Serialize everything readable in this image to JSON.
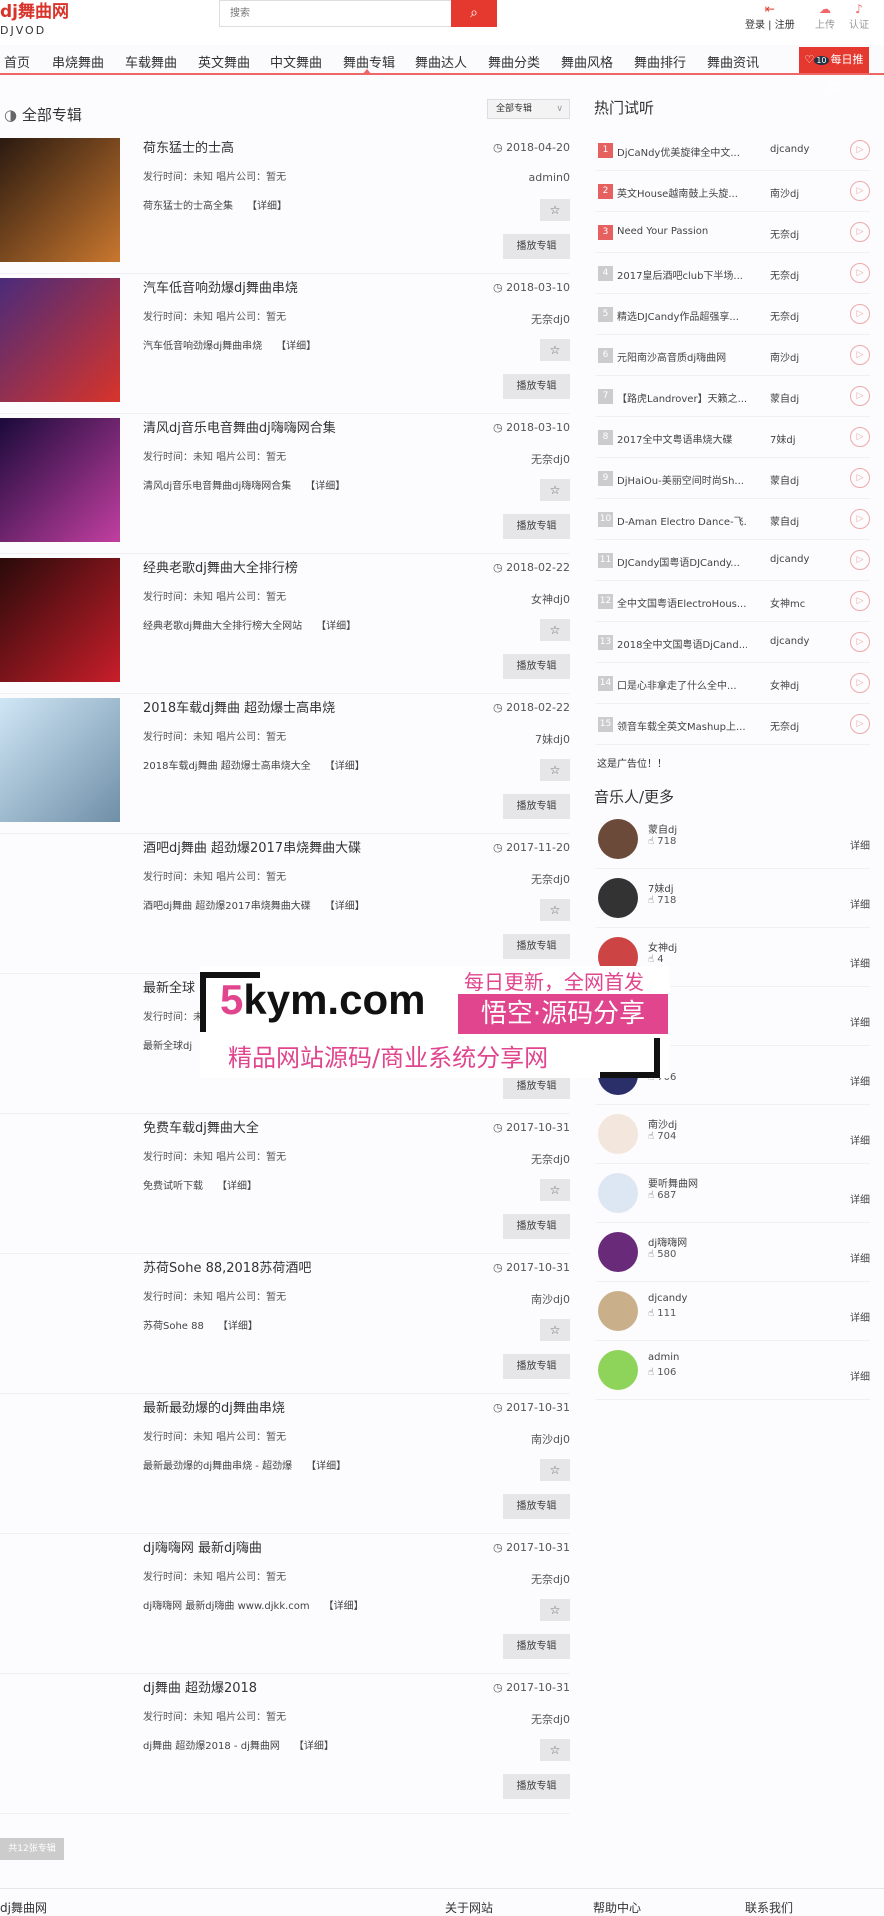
{
  "header": {
    "logo": "dj舞曲网",
    "logo_sub": "DJVOD",
    "search_placeholder": "搜索",
    "login": "登录 | 注册",
    "upload": "上传",
    "verify": "认证"
  },
  "nav": {
    "items": [
      "首页",
      "串烧舞曲",
      "车载舞曲",
      "英文舞曲",
      "中文舞曲",
      "舞曲专辑",
      "舞曲达人",
      "舞曲分类",
      "舞曲风格",
      "舞曲排行",
      "舞曲资讯"
    ],
    "active": "舞曲专辑",
    "daily": "每日推荐",
    "daily_badge": "10"
  },
  "main": {
    "title": "全部专辑",
    "filter": "全部专辑",
    "meta": "发行时间：未知 唱片公司：暂无",
    "more": "【详细】",
    "play": "播放专辑",
    "pager": "共12张专辑",
    "albums": [
      {
        "title": "荷东猛士的士高",
        "desc": "荷东猛士的士高全集",
        "date": "2018-04-20",
        "author": "admin0",
        "cover": [
          "#2a1a10",
          "#c9772e"
        ]
      },
      {
        "title": "汽车低音响劲爆dj舞曲串烧",
        "desc": "汽车低音响劲爆dj舞曲串烧",
        "date": "2018-03-10",
        "author": "无奈dj0",
        "cover": [
          "#4a2b7a",
          "#d8342a"
        ]
      },
      {
        "title": "清风dj音乐电音舞曲dj嗨嗨网合集",
        "desc": "清风dj音乐电音舞曲dj嗨嗨网合集",
        "date": "2018-03-10",
        "author": "无奈dj0",
        "cover": [
          "#1a0a3a",
          "#c23fa0"
        ]
      },
      {
        "title": "经典老歌dj舞曲大全排行榜",
        "desc": "经典老歌dj舞曲大全排行榜大全网站",
        "date": "2018-02-22",
        "author": "女神dj0",
        "cover": [
          "#2a0a0a",
          "#c81e2a"
        ]
      },
      {
        "title": "2018车载dj舞曲 超劲爆士高串烧",
        "desc": "2018车载dj舞曲 超劲爆士高串烧大全",
        "date": "2018-02-22",
        "author": "7妹dj0",
        "cover": [
          "#cfe6f5",
          "#6f8fa8"
        ]
      },
      {
        "title": "酒吧dj舞曲 超劲爆2017串烧舞曲大碟",
        "desc": "酒吧dj舞曲 超劲爆2017串烧舞曲大碟",
        "date": "2017-11-20",
        "author": "无奈dj0"
      },
      {
        "title": "最新全球",
        "desc": "最新全球dj",
        "date": "",
        "author": ""
      },
      {
        "title": "免费车载dj舞曲大全",
        "desc": "免费试听下载",
        "date": "2017-10-31",
        "author": "无奈dj0"
      },
      {
        "title": "苏荷Sohe 88,2018苏荷酒吧",
        "desc": "苏荷Sohe 88",
        "date": "2017-10-31",
        "author": "南沙dj0"
      },
      {
        "title": "最新最劲爆的dj舞曲串烧",
        "desc": "最新最劲爆的dj舞曲串烧 - 超劲爆",
        "date": "2017-10-31",
        "author": "南沙dj0"
      },
      {
        "title": "dj嗨嗨网 最新dj嗨曲",
        "desc": "dj嗨嗨网 最新dj嗨曲 www.djkk.com",
        "date": "2017-10-31",
        "author": "无奈dj0"
      },
      {
        "title": "dj舞曲 超劲爆2018",
        "desc": "dj舞曲 超劲爆2018 - dj舞曲网",
        "date": "2017-10-31",
        "author": "无奈dj0"
      }
    ]
  },
  "sidebar": {
    "hot_title": "热门试听",
    "ad": "这是广告位！！",
    "musicians_title": "音乐人/更多",
    "detail": "详细",
    "hot": [
      {
        "n": "1",
        "t": "DjCaNdy优美旋律全中文...",
        "a": "djcandy"
      },
      {
        "n": "2",
        "t": "英文House越南鼓上头旋...",
        "a": "南沙dj"
      },
      {
        "n": "3",
        "t": "Need Your Passion",
        "a": "无奈dj"
      },
      {
        "n": "4",
        "t": "2017皇后酒吧club下半场...",
        "a": "无奈dj"
      },
      {
        "n": "5",
        "t": "精选DJCandy作品超强享...",
        "a": "无奈dj"
      },
      {
        "n": "6",
        "t": "元阳南沙高音质dj嗨曲网",
        "a": "南沙dj"
      },
      {
        "n": "7",
        "t": "【路虎Landrover】天籁之...",
        "a": "蒙自dj"
      },
      {
        "n": "8",
        "t": "2017全中文粤语串烧大碟",
        "a": "7妹dj"
      },
      {
        "n": "9",
        "t": "DjHaiOu-美丽空间时尚Sh...",
        "a": "蒙自dj"
      },
      {
        "n": "10",
        "t": "D-Aman Electro Dance-飞...",
        "a": "蒙自dj"
      },
      {
        "n": "11",
        "t": "DJCandy国粤语DJCandy...",
        "a": "djcandy"
      },
      {
        "n": "12",
        "t": "全中文国粤语ElectroHous...",
        "a": "女神mc"
      },
      {
        "n": "13",
        "t": "2018全中文国粤语DjCand...",
        "a": "djcandy"
      },
      {
        "n": "14",
        "t": "口是心非拿走了什么全中...",
        "a": "女神dj"
      },
      {
        "n": "15",
        "t": "领音车载全英文Mashup上...",
        "a": "无奈dj"
      }
    ],
    "musicians": [
      {
        "name": "蒙自dj",
        "count": "718",
        "color": "#6b4a3a"
      },
      {
        "name": "7妹dj",
        "count": "718",
        "color": "#333"
      },
      {
        "name": "女神dj",
        "count": "4",
        "color": "#c44"
      },
      {
        "name": "j",
        "count": "9",
        "color": "#888"
      },
      {
        "name": "",
        "count": "706",
        "color": "#2a2f6a"
      },
      {
        "name": "南沙dj",
        "count": "704",
        "color": "#f3e6dc"
      },
      {
        "name": "要听舞曲网",
        "count": "687",
        "color": "#dde6f3"
      },
      {
        "name": "dj嗨嗨网",
        "count": "580",
        "color": "#6a2a7a"
      },
      {
        "name": "djcandy",
        "count": "111",
        "color": "#c9b08a"
      },
      {
        "name": "admin",
        "count": "106",
        "color": "#8fd45a"
      }
    ]
  },
  "footer": {
    "items": [
      "dj舞曲网",
      "关于网站",
      "帮助中心",
      "联系我们"
    ]
  },
  "watermark": {
    "site_num": "5",
    "site": "kym.com",
    "slogan1": "每日更新，全网首发",
    "slogan2": "悟空·源码分享",
    "slogan3": "精品网站源码/商业系统分享网"
  },
  "colors": {
    "accent": "#e5382e",
    "watermark": "#e0458e"
  }
}
